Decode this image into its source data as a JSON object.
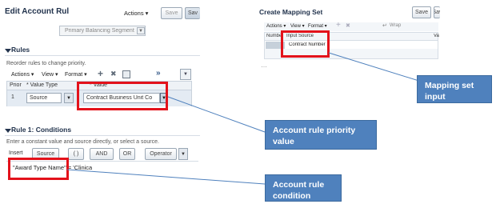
{
  "left_panel": {
    "title": "Edit Account Rul",
    "actions_label": "Actions ▾",
    "save_label": "Save",
    "save_close_label": "Sav",
    "segment_select_value": "Primary Balancing Segment",
    "rules_section": {
      "title": "Rules",
      "hint": "Reorder rules to change priority.",
      "toolbar": {
        "actions": "Actions ▾",
        "view": "View ▾",
        "format": "Format ▾",
        "add": "+",
        "delete": "✖",
        "more": "»"
      },
      "columns": [
        "Prior",
        "* Value Type",
        "* Value"
      ],
      "rows": [
        {
          "priority": "1",
          "value_type": "Source",
          "value": "Contract Business Unit Co"
        }
      ]
    },
    "conditions_section": {
      "title": "Rule 1: Conditions",
      "hint": "Enter a constant value and source directly, or select a source.",
      "insert_label": "Insert",
      "buttons": [
        "Source",
        "( )",
        "AND",
        "OR",
        "Operator"
      ],
      "condition_text": "\"Award Type Name\" = 'Clinica"
    }
  },
  "right_panel": {
    "title": "Create Mapping Set",
    "save_label": "Save",
    "save_close_label": "Sav",
    "toolbar": {
      "actions": "Actions ▾",
      "view": "View ▾",
      "format": "Format ▾",
      "wrap": "Wrap"
    },
    "columns": [
      "Number",
      "Input Source",
      "Va"
    ],
    "input_source_value": "Contract Number",
    "ellipsis": "…"
  },
  "callouts": {
    "mapping_set": "Mapping set input",
    "priority_value": "Account rule priority value",
    "condition": "Account rule condition"
  },
  "colors": {
    "callout_bg": "#4f81bd",
    "highlight_red": "#e3121b",
    "header_blue": "#22334d"
  }
}
